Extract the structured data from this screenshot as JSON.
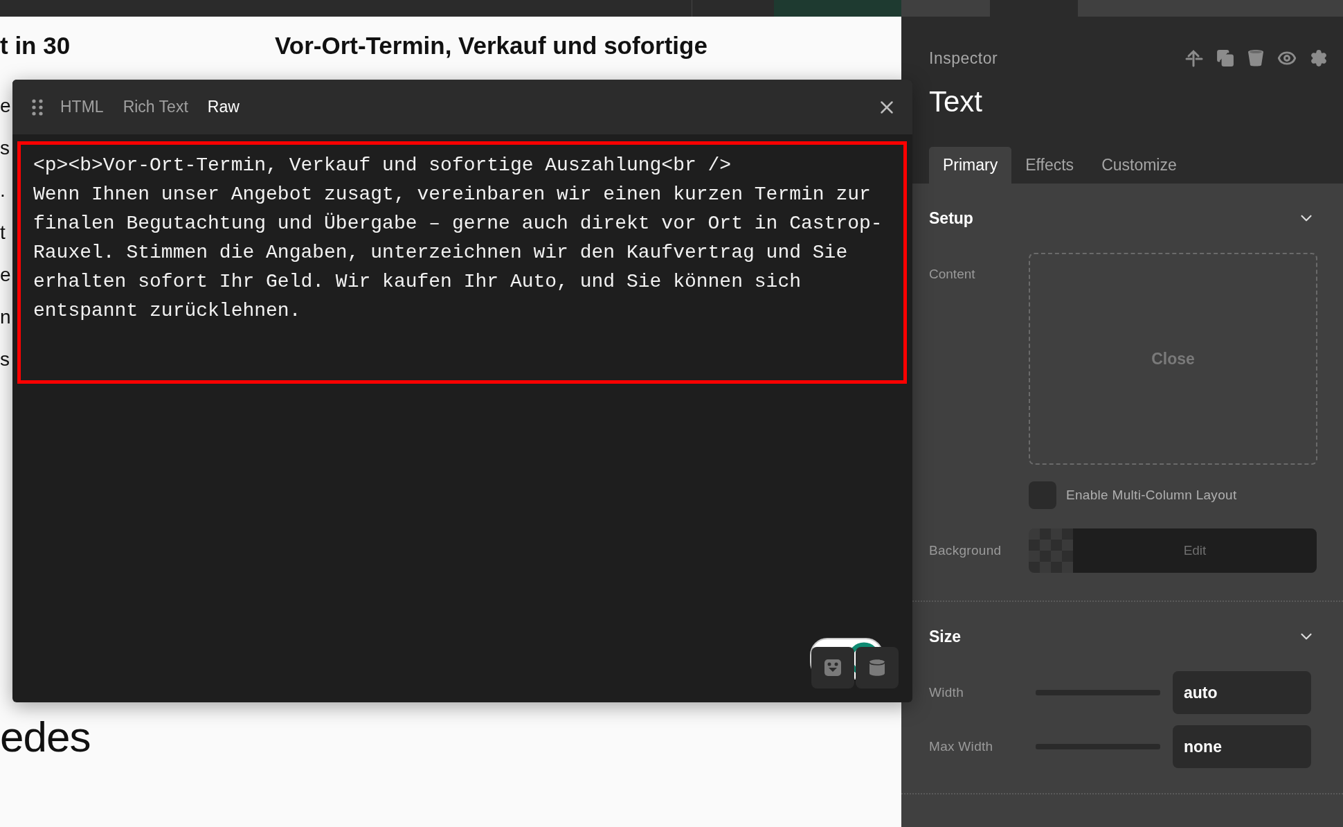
{
  "canvas": {
    "heading_left": "t in 30",
    "heading_right_lines": [
      "Vor-Ort-Termin, Verkauf und sofortige"
    ],
    "text_fragments": [
      "e",
      "s",
      ".",
      "t",
      "e",
      "n",
      "s"
    ],
    "bottom_heading": "edes"
  },
  "editor": {
    "tabs": [
      {
        "label": "HTML",
        "selected": false
      },
      {
        "label": "Rich Text",
        "selected": false
      },
      {
        "label": "Raw",
        "selected": true
      }
    ],
    "content": "<p><b>Vor-Ort-Termin, Verkauf und sofortige Auszahlung<br />\nWenn Ihnen unser Angebot zusagt, vereinbaren wir einen kurzen Termin zur finalen Begutachtung und Übergabe – gerne auch direkt vor Ort in Castrop-Rauxel. Stimmen die Angaben, unterzeichnen wir den Kaufvertrag und Sie erhalten sofort Ihr Geld. Wir kaufen Ihr Auto, und Sie können sich entspannt zurücklehnen."
  },
  "inspector": {
    "label": "Inspector",
    "title": "Text",
    "tabs": [
      {
        "label": "Primary",
        "selected": true
      },
      {
        "label": "Effects",
        "selected": false
      },
      {
        "label": "Customize",
        "selected": false
      }
    ],
    "setup": {
      "title": "Setup",
      "expanded": true,
      "content_label": "Content",
      "dropzone_text": "Close",
      "multi_column": {
        "label": "Enable Multi-Column Layout",
        "checked": false
      },
      "background_label": "Background",
      "background_button": "Edit"
    },
    "size": {
      "title": "Size",
      "expanded": true,
      "rows": [
        {
          "label": "Width",
          "value": "auto"
        },
        {
          "label": "Max Width",
          "value": "none"
        }
      ]
    }
  }
}
